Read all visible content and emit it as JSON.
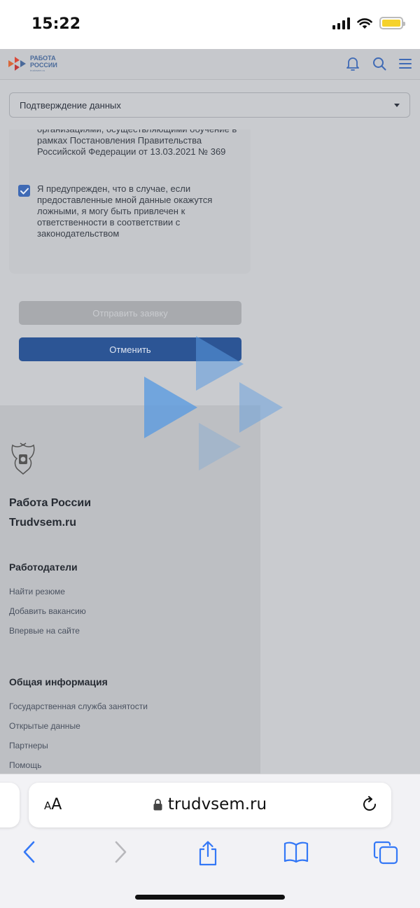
{
  "status_bar": {
    "time": "15:22"
  },
  "header": {
    "logo_line1": "РАБОТА",
    "logo_line2": "РОССИИ",
    "logo_sub": "trudvsem.ru"
  },
  "section_select": {
    "value": "Подтверждение данных"
  },
  "form": {
    "clipped_text": "организациями, осуществляющими обучение в рамках Постановления Правительства Российской Федерации от 13.03.2021 № 369",
    "warning_checkbox_checked": true,
    "warning_checkbox_label": "Я предупрежден, что в случае, если предоставленные мной данные окажутся ложными, я могу быть привлечен к ответственности в соответствии с законодательством",
    "submit_label": "Отправить заявку",
    "cancel_label": "Отменить"
  },
  "footer": {
    "brand_line1": "Работа России",
    "brand_line2": "Trudvsem.ru",
    "employers_heading": "Работодатели",
    "employers_links": [
      "Найти резюме",
      "Добавить вакансию",
      "Впервые на сайте"
    ],
    "info_heading": "Общая информация",
    "info_links": [
      "Государственная служба занятости",
      "Открытые данные",
      "Партнеры",
      "Помощь"
    ]
  },
  "browser": {
    "aa_label": "AA",
    "url": "trudvsem.ru"
  },
  "colors": {
    "accent": "#2c5595",
    "checkbox": "#3f6ab5",
    "watermark": "#5b9be0",
    "overlay": "#c9cbcf"
  }
}
